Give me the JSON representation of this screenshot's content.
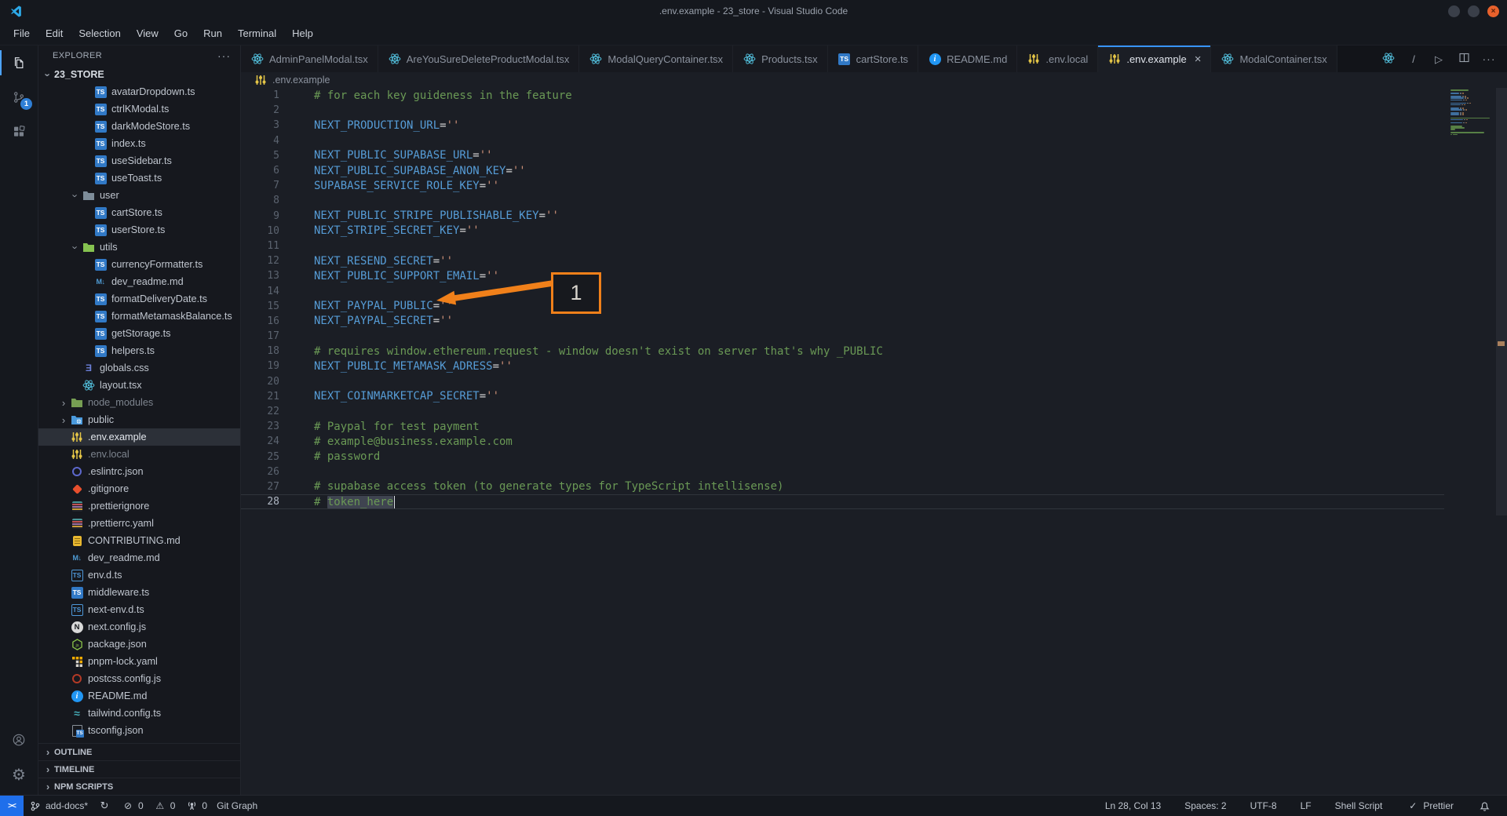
{
  "window": {
    "title": ".env.example - 23_store - Visual Studio Code",
    "controls": [
      "minimize",
      "maximize",
      "close"
    ]
  },
  "menu": [
    "File",
    "Edit",
    "Selection",
    "View",
    "Go",
    "Run",
    "Terminal",
    "Help"
  ],
  "activity": {
    "top": [
      {
        "icon": "files",
        "active": true
      },
      {
        "icon": "source-control",
        "badge": "1"
      },
      {
        "icon": "extensions"
      }
    ],
    "bottom": [
      {
        "icon": "account"
      },
      {
        "icon": "settings-gear"
      }
    ]
  },
  "explorer": {
    "title": "EXPLORER",
    "more_label": "···",
    "root": "23_STORE",
    "sections": [
      "OUTLINE",
      "TIMELINE",
      "NPM SCRIPTS"
    ]
  },
  "tree": [
    {
      "name": "avatarDropdown.ts",
      "icon": "ts",
      "level": 3
    },
    {
      "name": "ctrlKModal.ts",
      "icon": "ts",
      "level": 3
    },
    {
      "name": "darkModeStore.ts",
      "icon": "ts",
      "level": 3
    },
    {
      "name": "index.ts",
      "icon": "ts",
      "level": 3
    },
    {
      "name": "useSidebar.ts",
      "icon": "ts",
      "level": 3
    },
    {
      "name": "useToast.ts",
      "icon": "ts",
      "level": 3
    },
    {
      "name": "user",
      "icon": "folder",
      "color": "#7d8c99",
      "level": 2,
      "kind": "folder",
      "expanded": true
    },
    {
      "name": "cartStore.ts",
      "icon": "ts",
      "level": 3
    },
    {
      "name": "userStore.ts",
      "icon": "ts",
      "level": 3
    },
    {
      "name": "utils",
      "icon": "folder",
      "color": "#85c250",
      "level": 2,
      "kind": "folder",
      "expanded": true
    },
    {
      "name": "currencyFormatter.ts",
      "icon": "ts",
      "level": 3
    },
    {
      "name": "dev_readme.md",
      "icon": "md",
      "level": 3
    },
    {
      "name": "formatDeliveryDate.ts",
      "icon": "ts",
      "level": 3
    },
    {
      "name": "formatMetamaskBalance.ts",
      "icon": "ts",
      "level": 3
    },
    {
      "name": "getStorage.ts",
      "icon": "ts",
      "level": 3
    },
    {
      "name": "helpers.ts",
      "icon": "ts",
      "level": 3
    },
    {
      "name": "globals.css",
      "icon": "css",
      "level": 2
    },
    {
      "name": "layout.tsx",
      "icon": "react",
      "level": 2
    },
    {
      "name": "node_modules",
      "icon": "folder",
      "color": "#769e53",
      "level": 1,
      "kind": "folder",
      "expanded": false,
      "dim": true
    },
    {
      "name": "public",
      "icon": "folder-globe",
      "color": "#4a9add",
      "level": 1,
      "kind": "folder",
      "expanded": false
    },
    {
      "name": ".env.example",
      "icon": "env",
      "level": 1,
      "selected": true
    },
    {
      "name": ".env.local",
      "icon": "env",
      "level": 1,
      "dim": true
    },
    {
      "name": ".eslintrc.json",
      "icon": "eslint",
      "level": 1
    },
    {
      "name": ".gitignore",
      "icon": "git",
      "level": 1
    },
    {
      "name": ".prettierignore",
      "icon": "prettier",
      "level": 1
    },
    {
      "name": ".prettierrc.yaml",
      "icon": "prettier",
      "level": 1
    },
    {
      "name": "CONTRIBUTING.md",
      "icon": "clipboard",
      "level": 1
    },
    {
      "name": "dev_readme.md",
      "icon": "md",
      "level": 1
    },
    {
      "name": "env.d.ts",
      "icon": "ts-outline",
      "level": 1
    },
    {
      "name": "middleware.ts",
      "icon": "ts",
      "level": 1
    },
    {
      "name": "next-env.d.ts",
      "icon": "ts-outline",
      "level": 1
    },
    {
      "name": "next.config.js",
      "icon": "nextjs",
      "level": 1
    },
    {
      "name": "package.json",
      "icon": "npm",
      "level": 1
    },
    {
      "name": "pnpm-lock.yaml",
      "icon": "pnpm",
      "level": 1
    },
    {
      "name": "postcss.config.js",
      "icon": "postcss",
      "level": 1
    },
    {
      "name": "README.md",
      "icon": "info",
      "level": 1
    },
    {
      "name": "tailwind.config.ts",
      "icon": "tailwind",
      "level": 1
    },
    {
      "name": "tsconfig.json",
      "icon": "tsconfig",
      "level": 1
    }
  ],
  "tabs": [
    {
      "label": "AdminPanelModal.tsx",
      "icon": "react"
    },
    {
      "label": "AreYouSureDeleteProductModal.tsx",
      "icon": "react"
    },
    {
      "label": "ModalQueryContainer.tsx",
      "icon": "react"
    },
    {
      "label": "Products.tsx",
      "icon": "react"
    },
    {
      "label": "cartStore.ts",
      "icon": "ts"
    },
    {
      "label": "README.md",
      "icon": "info"
    },
    {
      "label": ".env.local",
      "icon": "env"
    },
    {
      "label": ".env.example",
      "icon": "env",
      "active": true,
      "close": "×"
    },
    {
      "label": "ModalContainer.tsx",
      "icon": "react"
    }
  ],
  "editor_actions": [
    {
      "icon": "react"
    },
    {
      "icon": "slash"
    },
    {
      "icon": "play"
    },
    {
      "icon": "split"
    },
    {
      "icon": "more"
    }
  ],
  "breadcrumb": {
    "icon": "env",
    "file": ".env.example"
  },
  "code": {
    "lines": [
      {
        "n": 1,
        "tokens": [
          [
            "c",
            "# for each key guideness in the feature"
          ]
        ]
      },
      {
        "n": 2,
        "tokens": []
      },
      {
        "n": 3,
        "tokens": [
          [
            "v",
            "NEXT_PRODUCTION_URL"
          ],
          [
            "o",
            "="
          ],
          [
            "s",
            "''"
          ]
        ]
      },
      {
        "n": 4,
        "tokens": []
      },
      {
        "n": 5,
        "tokens": [
          [
            "v",
            "NEXT_PUBLIC_SUPABASE_URL"
          ],
          [
            "o",
            "="
          ],
          [
            "s",
            "''"
          ]
        ]
      },
      {
        "n": 6,
        "tokens": [
          [
            "v",
            "NEXT_PUBLIC_SUPABASE_ANON_KEY"
          ],
          [
            "o",
            "="
          ],
          [
            "s",
            "''"
          ]
        ]
      },
      {
        "n": 7,
        "tokens": [
          [
            "v",
            "SUPABASE_SERVICE_ROLE_KEY"
          ],
          [
            "o",
            "="
          ],
          [
            "s",
            "''"
          ]
        ]
      },
      {
        "n": 8,
        "tokens": []
      },
      {
        "n": 9,
        "tokens": [
          [
            "v",
            "NEXT_PUBLIC_STRIPE_PUBLISHABLE_KEY"
          ],
          [
            "o",
            "="
          ],
          [
            "s",
            "''"
          ]
        ]
      },
      {
        "n": 10,
        "tokens": [
          [
            "v",
            "NEXT_STRIPE_SECRET_KEY"
          ],
          [
            "o",
            "="
          ],
          [
            "s",
            "''"
          ]
        ]
      },
      {
        "n": 11,
        "tokens": []
      },
      {
        "n": 12,
        "tokens": [
          [
            "v",
            "NEXT_RESEND_SECRET"
          ],
          [
            "o",
            "="
          ],
          [
            "s",
            "''"
          ]
        ]
      },
      {
        "n": 13,
        "tokens": [
          [
            "v",
            "NEXT_PUBLIC_SUPPORT_EMAIL"
          ],
          [
            "o",
            "="
          ],
          [
            "s",
            "''"
          ]
        ]
      },
      {
        "n": 14,
        "tokens": []
      },
      {
        "n": 15,
        "tokens": [
          [
            "v",
            "NEXT_PAYPAL_PUBLIC"
          ],
          [
            "o",
            "="
          ],
          [
            "s",
            "''"
          ]
        ]
      },
      {
        "n": 16,
        "tokens": [
          [
            "v",
            "NEXT_PAYPAL_SECRET"
          ],
          [
            "o",
            "="
          ],
          [
            "s",
            "''"
          ]
        ]
      },
      {
        "n": 17,
        "tokens": []
      },
      {
        "n": 18,
        "tokens": [
          [
            "c",
            "# requires window.ethereum.request - window doesn't exist on server that's why _PUBLIC"
          ]
        ]
      },
      {
        "n": 19,
        "tokens": [
          [
            "v",
            "NEXT_PUBLIC_METAMASK_ADRESS"
          ],
          [
            "o",
            "="
          ],
          [
            "s",
            "''"
          ]
        ]
      },
      {
        "n": 20,
        "tokens": []
      },
      {
        "n": 21,
        "tokens": [
          [
            "v",
            "NEXT_COINMARKETCAP_SECRET"
          ],
          [
            "o",
            "="
          ],
          [
            "s",
            "''"
          ]
        ]
      },
      {
        "n": 22,
        "tokens": []
      },
      {
        "n": 23,
        "tokens": [
          [
            "c",
            "# Paypal for test payment"
          ]
        ]
      },
      {
        "n": 24,
        "tokens": [
          [
            "c",
            "# example@business.example.com"
          ]
        ]
      },
      {
        "n": 25,
        "tokens": [
          [
            "c",
            "# password"
          ]
        ]
      },
      {
        "n": 26,
        "tokens": []
      },
      {
        "n": 27,
        "tokens": [
          [
            "c",
            "# supabase access token (to generate types for TypeScript intellisense)"
          ]
        ]
      },
      {
        "n": 28,
        "tokens": [
          [
            "c",
            "# "
          ],
          [
            "sel",
            "token_here"
          ],
          [
            "cur",
            ""
          ]
        ]
      }
    ],
    "cursor_line": 28
  },
  "annotation": {
    "label": "1",
    "color": "#F0801A"
  },
  "status": {
    "left": [
      {
        "icon": "remote",
        "type": "remote"
      },
      {
        "icon": "branch",
        "text": "add-docs*"
      },
      {
        "icon": "sync"
      },
      {
        "icon": "error",
        "text": "0"
      },
      {
        "icon": "warning",
        "text": "0"
      },
      {
        "icon": "tower",
        "text": "0"
      },
      {
        "text": "Git Graph"
      }
    ],
    "right": [
      {
        "text": "Ln 28, Col 13"
      },
      {
        "text": "Spaces: 2"
      },
      {
        "text": "UTF-8"
      },
      {
        "text": "LF"
      },
      {
        "text": "Shell Script"
      },
      {
        "icon": "check",
        "text": "Prettier"
      },
      {
        "icon": "bell"
      }
    ]
  },
  "colors": {
    "accent": "#3794FF",
    "annotation_orange": "#F0801A",
    "comment": "#6A9955",
    "variable": "#569CD6",
    "string": "#CE9178",
    "selection": "#3F4450"
  }
}
